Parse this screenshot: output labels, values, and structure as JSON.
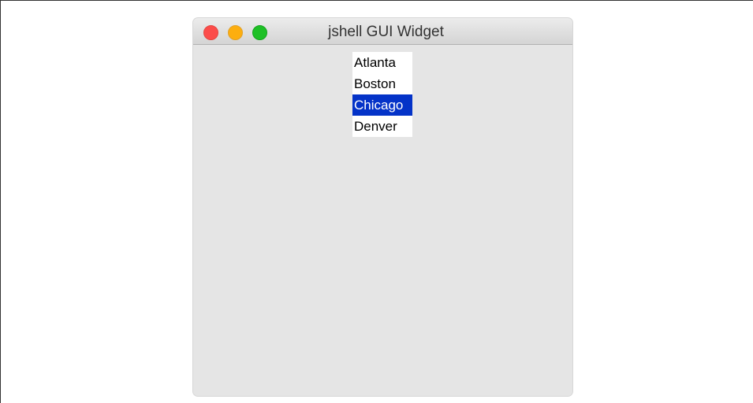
{
  "window": {
    "title": "jshell GUI Widget"
  },
  "list": {
    "items": [
      {
        "label": "Atlanta",
        "selected": false
      },
      {
        "label": "Boston",
        "selected": false
      },
      {
        "label": "Chicago",
        "selected": true
      },
      {
        "label": "Denver",
        "selected": false
      }
    ],
    "selected_index": 2
  },
  "colors": {
    "close": "#fc4c4a",
    "minimize": "#fdae0f",
    "zoom": "#1ec026",
    "selection": "#0433c8",
    "window_background": "#e5e5e5"
  }
}
